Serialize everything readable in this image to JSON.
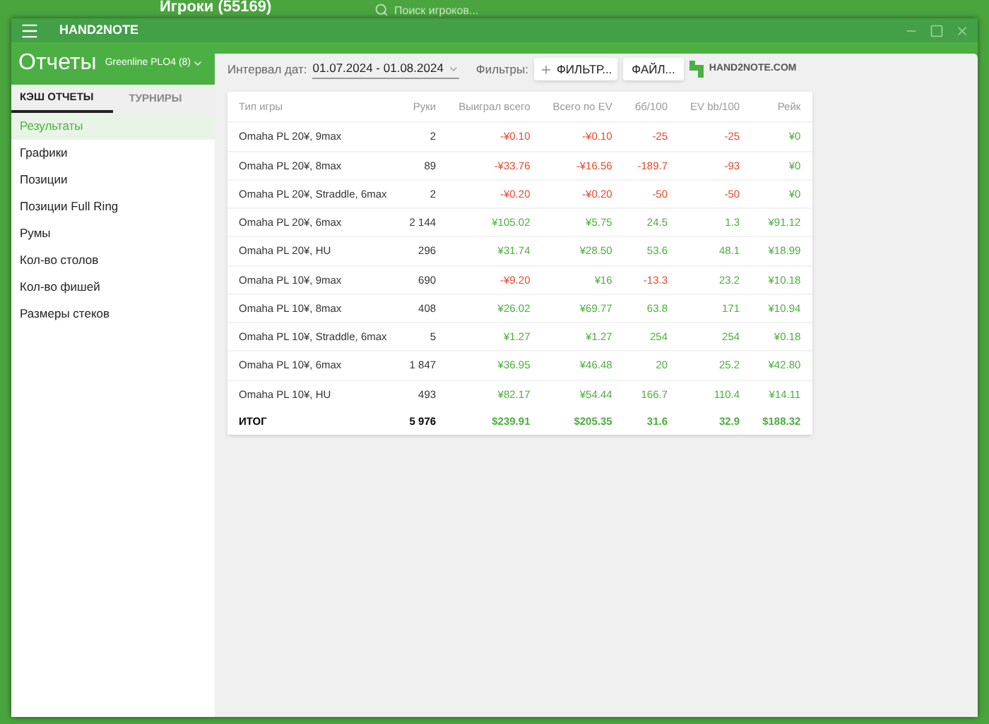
{
  "background_app": {
    "title": "Игроки (55169)",
    "search": {
      "placeholder": "Поиск игроков..."
    }
  },
  "window": {
    "title": "HAND2NOTE"
  },
  "header": {
    "title": "Отчеты",
    "database": "Greenline PLO4 (8)",
    "date_label": "Интервал дат:",
    "date_range": "01.07.2024 - 01.08.2024",
    "filters_label": "Фильтры:",
    "filter_button": "ФИЛЬТР...",
    "file_button": "ФАЙЛ...",
    "logo_text": "HAND2NOTE.COM"
  },
  "tabs": [
    {
      "label": "КЭШ ОТЧЕТЫ",
      "selected": true
    },
    {
      "label": "ТУРНИРЫ",
      "selected": false
    }
  ],
  "sidebar": {
    "items": [
      {
        "label": "Результаты",
        "selected": true
      },
      {
        "label": "Графики",
        "selected": false
      },
      {
        "label": "Позиции",
        "selected": false
      },
      {
        "label": "Позиции Full Ring",
        "selected": false
      },
      {
        "label": "Румы",
        "selected": false
      },
      {
        "label": "Кол-во столов",
        "selected": false
      },
      {
        "label": "Кол-во фишей",
        "selected": false
      },
      {
        "label": "Размеры стеков",
        "selected": false
      }
    ]
  },
  "table": {
    "columns": [
      "Тип игры",
      "Руки",
      "Выиграл всего",
      "Всего по EV",
      "бб/100",
      "EV bb/100",
      "Рейк"
    ],
    "rows": [
      {
        "game": "Omaha PL 20¥, 9max",
        "hands": "2",
        "values": [
          {
            "text": "-¥0.10",
            "negative": true
          },
          {
            "text": "-¥0.10",
            "negative": true
          },
          {
            "text": "-25",
            "negative": true
          },
          {
            "text": "-25",
            "negative": true
          },
          {
            "text": "¥0",
            "negative": false
          }
        ]
      },
      {
        "game": "Omaha PL 20¥, 8max",
        "hands": "89",
        "values": [
          {
            "text": "-¥33.76",
            "negative": true
          },
          {
            "text": "-¥16.56",
            "negative": true
          },
          {
            "text": "-189.7",
            "negative": true
          },
          {
            "text": "-93",
            "negative": true
          },
          {
            "text": "¥0",
            "negative": false
          }
        ]
      },
      {
        "game": "Omaha PL 20¥, Straddle, 6max",
        "hands": "2",
        "values": [
          {
            "text": "-¥0.20",
            "negative": true
          },
          {
            "text": "-¥0.20",
            "negative": true
          },
          {
            "text": "-50",
            "negative": true
          },
          {
            "text": "-50",
            "negative": true
          },
          {
            "text": "¥0",
            "negative": false
          }
        ]
      },
      {
        "game": "Omaha PL 20¥, 6max",
        "hands": "2 144",
        "values": [
          {
            "text": "¥105.02",
            "negative": false
          },
          {
            "text": "¥5.75",
            "negative": false
          },
          {
            "text": "24.5",
            "negative": false
          },
          {
            "text": "1.3",
            "negative": false
          },
          {
            "text": "¥91.12",
            "negative": false
          }
        ]
      },
      {
        "game": "Omaha PL 20¥, HU",
        "hands": "296",
        "values": [
          {
            "text": "¥31.74",
            "negative": false
          },
          {
            "text": "¥28.50",
            "negative": false
          },
          {
            "text": "53.6",
            "negative": false
          },
          {
            "text": "48.1",
            "negative": false
          },
          {
            "text": "¥18.99",
            "negative": false
          }
        ]
      },
      {
        "game": "Omaha PL 10¥, 9max",
        "hands": "690",
        "values": [
          {
            "text": "-¥9.20",
            "negative": true
          },
          {
            "text": "¥16",
            "negative": false
          },
          {
            "text": "-13.3",
            "negative": true
          },
          {
            "text": "23.2",
            "negative": false
          },
          {
            "text": "¥10.18",
            "negative": false
          }
        ]
      },
      {
        "game": "Omaha PL 10¥, 8max",
        "hands": "408",
        "values": [
          {
            "text": "¥26.02",
            "negative": false
          },
          {
            "text": "¥69.77",
            "negative": false
          },
          {
            "text": "63.8",
            "negative": false
          },
          {
            "text": "171",
            "negative": false
          },
          {
            "text": "¥10.94",
            "negative": false
          }
        ]
      },
      {
        "game": "Omaha PL 10¥, Straddle, 6max",
        "hands": "5",
        "values": [
          {
            "text": "¥1.27",
            "negative": false
          },
          {
            "text": "¥1.27",
            "negative": false
          },
          {
            "text": "254",
            "negative": false
          },
          {
            "text": "254",
            "negative": false
          },
          {
            "text": "¥0.18",
            "negative": false
          }
        ]
      },
      {
        "game": "Omaha PL 10¥, 6max",
        "hands": "1 847",
        "values": [
          {
            "text": "¥36.95",
            "negative": false
          },
          {
            "text": "¥46.48",
            "negative": false
          },
          {
            "text": "20",
            "negative": false
          },
          {
            "text": "25.2",
            "negative": false
          },
          {
            "text": "¥42.80",
            "negative": false
          }
        ]
      },
      {
        "game": "Omaha PL 10¥, HU",
        "hands": "493",
        "values": [
          {
            "text": "¥82.17",
            "negative": false
          },
          {
            "text": "¥54.44",
            "negative": false
          },
          {
            "text": "166.7",
            "negative": false
          },
          {
            "text": "110.4",
            "negative": false
          },
          {
            "text": "¥14.11",
            "negative": false
          }
        ]
      }
    ],
    "total": {
      "game": "ИТОГ",
      "hands": "5 976",
      "values": [
        {
          "text": "$239.91",
          "negative": false
        },
        {
          "text": "$205.35",
          "negative": false
        },
        {
          "text": "31.6",
          "negative": false
        },
        {
          "text": "32.9",
          "negative": false
        },
        {
          "text": "$188.32",
          "negative": false
        }
      ]
    }
  }
}
